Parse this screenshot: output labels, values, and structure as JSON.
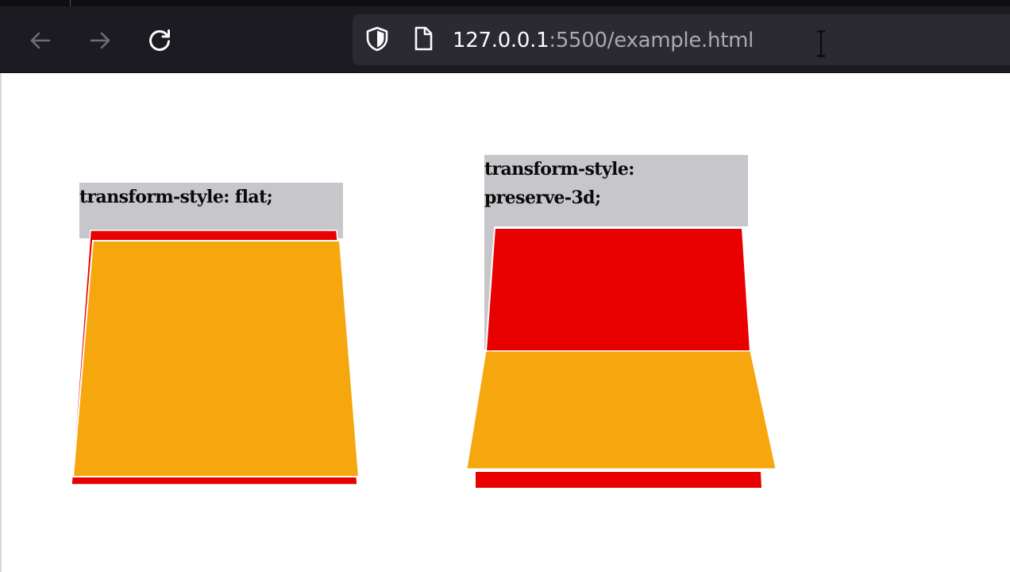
{
  "browser": {
    "url_host": "127.0.0.1",
    "url_rest": ":5500/example.html",
    "icons": {
      "back": "arrow-left-icon",
      "forward": "arrow-right-icon",
      "reload": "reload-icon",
      "tracking_protection": "shield-icon",
      "page_info": "document-icon",
      "cursor": "text-cursor-icon"
    },
    "colors": {
      "toolbar_bg": "#1c1b22",
      "urlbar_bg": "#2b2a33",
      "url_host": "#fbfbfe",
      "url_rest": "#a9a8b3"
    }
  },
  "demos": [
    {
      "label_lines": [
        "transform-style: flat;"
      ]
    },
    {
      "label_lines": [
        "transform-style:",
        "preserve-3d;"
      ]
    }
  ],
  "colors": {
    "container_gray": "#c7c6cb",
    "red_card": "#e90000",
    "orange_card": "#f6a70d",
    "card_edge": "#ffffff"
  }
}
